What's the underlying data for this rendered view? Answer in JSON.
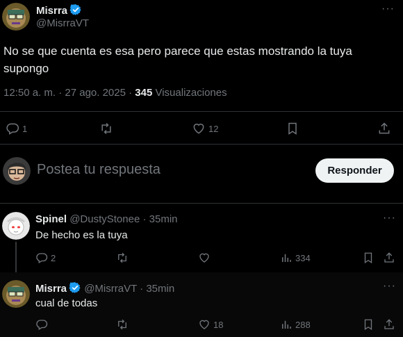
{
  "main_post": {
    "author_name": "Misrra",
    "author_handle": "@MisrraVT",
    "text": "No se que cuenta es esa pero parece que estas mostrando la tuya supongo",
    "timestamp": "12:50 a. m. · 27 ago. 2025 · ",
    "views_count": "345",
    "views_label": " Visualizaciones",
    "replies": "1",
    "reposts": "",
    "likes": "12"
  },
  "composer": {
    "placeholder": "Postea tu respuesta",
    "reply_label": "Responder"
  },
  "replies": [
    {
      "author_name": "Spinel",
      "author_handle": "@DustyStonee",
      "time": "· 35min",
      "text": "De hecho es la tuya",
      "replies": "2",
      "likes": "",
      "views": "334",
      "verified": false
    },
    {
      "author_name": "Misrra",
      "author_handle": "@MisrraVT",
      "time": "· 35min",
      "text": "cual de todas",
      "replies": "",
      "likes": "18",
      "views": "288",
      "verified": true
    }
  ],
  "colors": {
    "verified": "#1d9bf0",
    "background": "#000000",
    "muted": "#71767b",
    "text": "#e7e9ea",
    "divider": "#2f3336"
  },
  "icons": [
    "more-icon",
    "reply-icon",
    "repost-icon",
    "like-icon",
    "bookmark-icon",
    "share-icon",
    "views-icon",
    "verified-icon"
  ]
}
